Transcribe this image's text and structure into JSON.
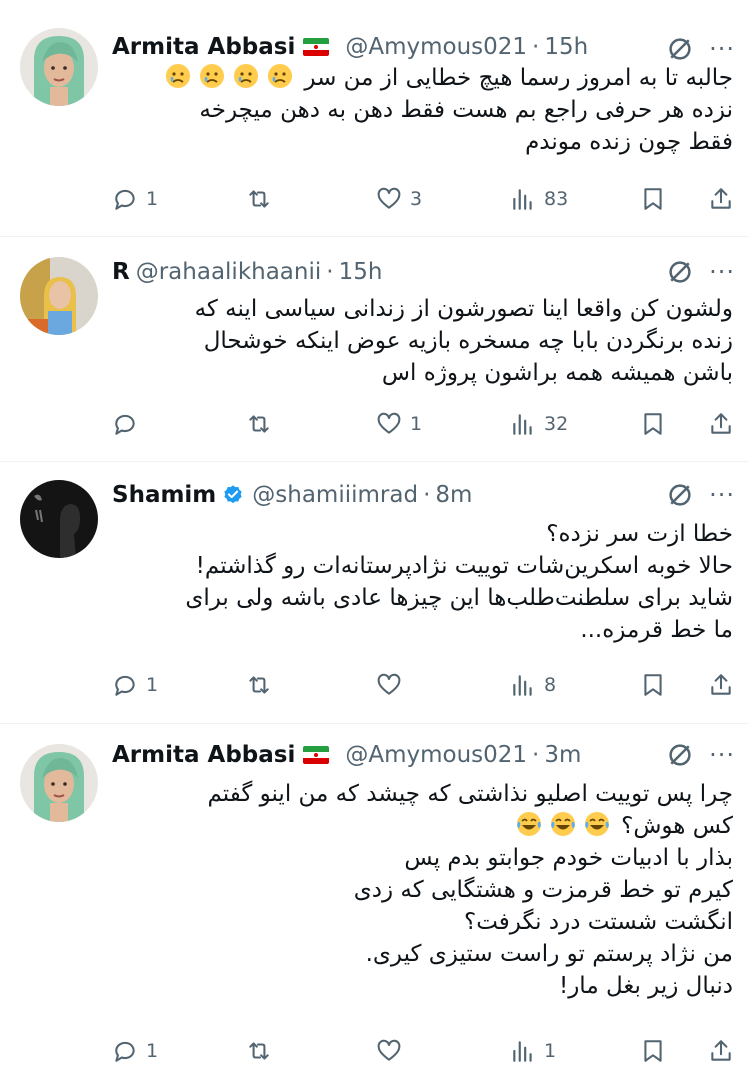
{
  "tweets": [
    {
      "name": "Armita Abbasi",
      "has_flag": true,
      "verified": false,
      "handle": "@Amymous021",
      "time": "15h",
      "lines": [
        "جالبه تا به امروز رسما هیچ خطایی از من سر",
        "نزده هر حرفی راجع بم هست فقط دهن به دهن میچرخه",
        "فقط چون زنده موندم"
      ],
      "emoji": "crying-face-emoji",
      "emoji_count": 4,
      "replies": "1",
      "retweets": "",
      "likes": "3",
      "views": "83"
    },
    {
      "name": "R",
      "has_flag": false,
      "verified": false,
      "handle": "@rahaalikhaanii",
      "time": "15h",
      "lines": [
        "ولشون کن واقعا اینا تصورشون از زندانی سیاسی اینه که",
        "زنده برنگردن بابا چه مسخره بازیه عوض اینکه خوشحال",
        "باشن همیشه همه براشون پروژه اس"
      ],
      "replies": "",
      "retweets": "",
      "likes": "1",
      "views": "32"
    },
    {
      "name": "Shamim",
      "has_flag": false,
      "verified": true,
      "handle": "@shamiiimrad",
      "time": "8m",
      "lines": [
        "خطا ازت سر نزده؟",
        "حالا خوبه اسکرین‌شات توییت نژادپرستانه‌ات رو گذاشتم!",
        "شاید برای سلطنت‌طلب‌ها این چیزها عادی باشه ولی برای",
        "ما خط قرمزه..."
      ],
      "replies": "1",
      "retweets": "",
      "likes": "",
      "views": "8"
    },
    {
      "name": "Armita Abbasi",
      "has_flag": true,
      "verified": false,
      "handle": "@Amymous021",
      "time": "3m",
      "lines": [
        "چرا پس توییت اصلیو نذاشتی که چیشد که من اینو گفتم",
        "کس هوش؟",
        "بذار با ادبیات خودم جوابتو بدم پس",
        "کیرم تو خط قرمزت و هشتگایی که زدی",
        "انگشت شستت درد نگرفت؟",
        "من نژاد پرستم تو راست ستیزی کیری.",
        "دنبال زیر بغل مار!"
      ],
      "emoji": "tears-of-joy-emoji",
      "emoji_count": 3,
      "replies": "1",
      "retweets": "",
      "likes": "",
      "views": "1"
    }
  ],
  "icons": {
    "reply": "reply-icon",
    "retweet": "retweet-icon",
    "like": "heart-icon",
    "views": "views-icon",
    "bookmark": "bookmark-icon",
    "share": "share-icon",
    "grok": "grok-icon",
    "more": "more-icon"
  },
  "colors": {
    "text": "#0f1419",
    "secondary": "#536471",
    "verified": "#1d9bf0",
    "divider": "#eff3f4"
  }
}
